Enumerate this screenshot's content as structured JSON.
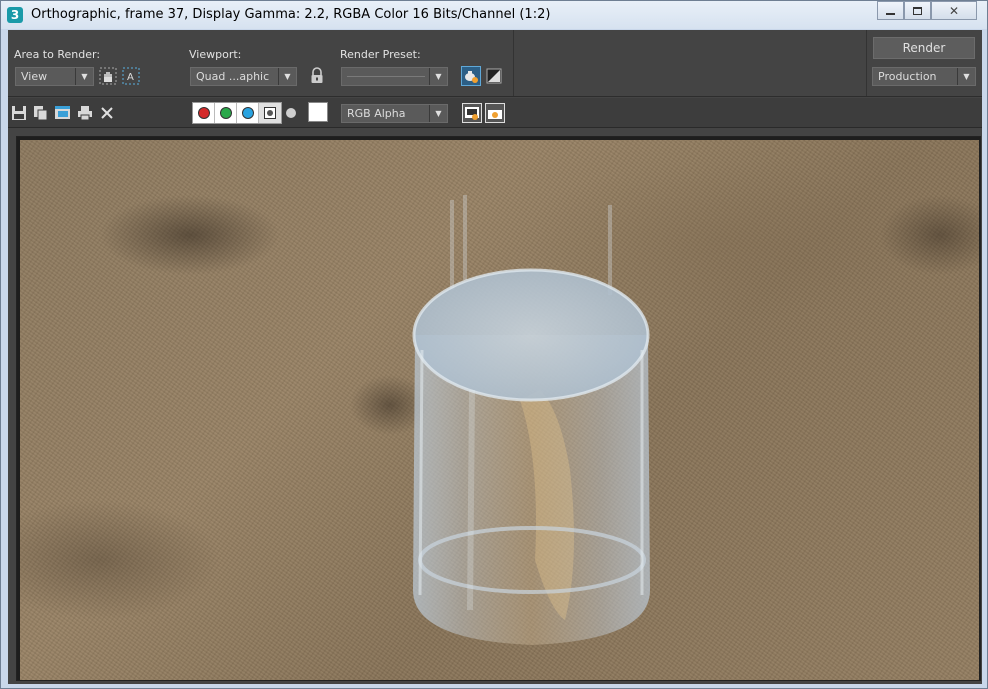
{
  "window": {
    "app_icon_text": "3",
    "title": "Orthographic, frame 37, Display Gamma: 2.2, RGBA Color 16 Bits/Channel (1:2)",
    "minimize_icon": "minimize-icon",
    "restore_icon": "restore-icon",
    "close_icon": "close-icon"
  },
  "area_to_render": {
    "label": "Area to Render:",
    "value": "View"
  },
  "viewport": {
    "label": "Viewport:",
    "value": "Quad ...aphic"
  },
  "render_preset": {
    "label": "Render Preset:",
    "value": ""
  },
  "render": {
    "button_label": "Render",
    "mode_value": "Production"
  },
  "display": {
    "channel_value": "RGB Alpha",
    "colors": {
      "red": "#d42a2a",
      "green": "#2aa84a",
      "blue": "#29a3e0"
    }
  }
}
